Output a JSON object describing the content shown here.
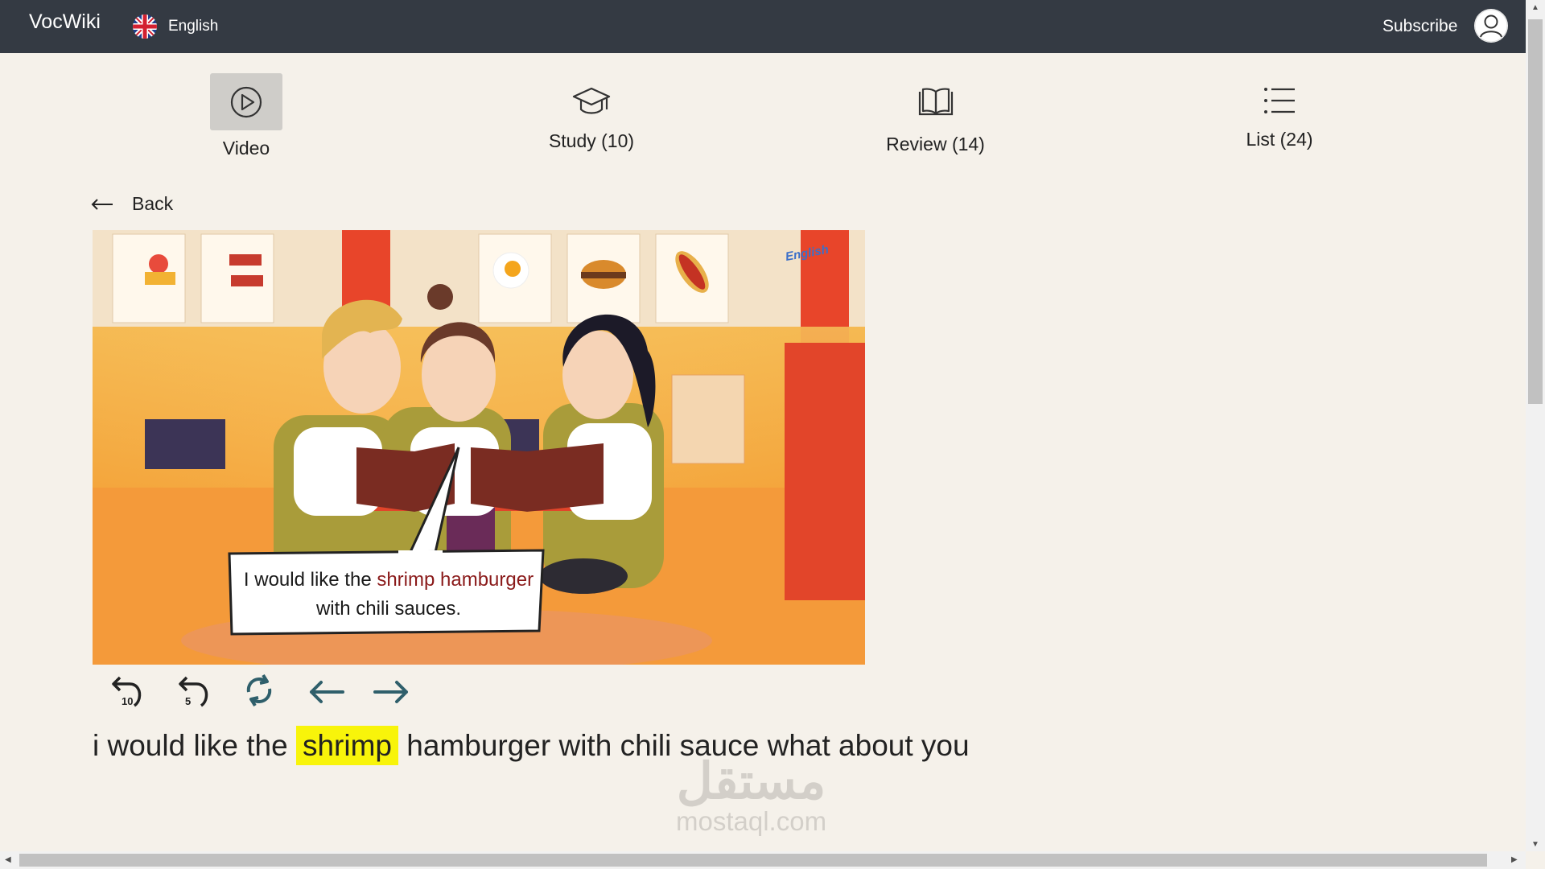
{
  "header": {
    "brand": "VocWiki",
    "language": "English",
    "subscribe": "Subscribe"
  },
  "tabs": [
    {
      "label": "Video",
      "icon": "play-icon",
      "active": true
    },
    {
      "label": "Study (10)",
      "icon": "graduation-cap-icon",
      "active": false
    },
    {
      "label": "Review (14)",
      "icon": "book-icon",
      "active": false
    },
    {
      "label": "List (24)",
      "icon": "list-icon",
      "active": false
    }
  ],
  "back": {
    "label": "Back",
    "icon": "left-arrow-icon"
  },
  "video": {
    "speech_line1_a": "I would like the ",
    "speech_line1_b": "shrimp hamburger",
    "speech_line2": "with chili sauces.",
    "logo_text": "English"
  },
  "controls": [
    {
      "icon": "rewind-10-icon",
      "label": "10"
    },
    {
      "icon": "rewind-5-icon",
      "label": "5"
    },
    {
      "icon": "repeat-icon"
    },
    {
      "icon": "previous-arrow-icon"
    },
    {
      "icon": "next-arrow-icon"
    }
  ],
  "transcript": {
    "before": "i would like the ",
    "highlight": "shrimp",
    "after": " hamburger with chili sauce what about you"
  },
  "watermark": {
    "arabic": "مستقل",
    "latin": "mostaql.com"
  },
  "colors": {
    "header_bg": "#343a43",
    "page_bg": "#f5f1ea",
    "highlight": "#f8f40a",
    "control_icon": "#2f5f6b"
  }
}
